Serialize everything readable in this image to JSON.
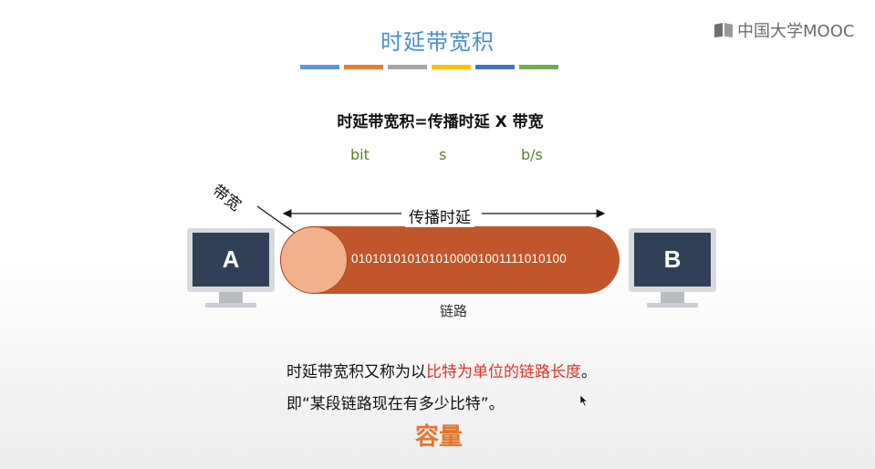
{
  "slide": {
    "title": "时延带宽积",
    "color_bar": [
      "#5b9bd5",
      "#ed7d31",
      "#a5a5a5",
      "#ffc000",
      "#4472c4",
      "#70ad47"
    ]
  },
  "logo": {
    "text": "中国大学MOOC"
  },
  "formula": {
    "text": "时延带宽积=传播时延 X 带宽",
    "units": {
      "delay_product": "bit",
      "propagation": "s",
      "bandwidth": "b/s"
    }
  },
  "diagram": {
    "host_a": "A",
    "host_b": "B",
    "bits": "0101010101010100001001111010100",
    "propagation_label": "传播时延",
    "bandwidth_label": "带宽",
    "link_label": "链路",
    "pipe_color": "#c0562a",
    "cap_color": "#f2b08d"
  },
  "description": {
    "line1_prefix": "时延带宽积又称为以",
    "line1_highlight": "比特为单位的链路长度",
    "line1_suffix": "。",
    "line2": "即“某段链路现在有多少比特”。",
    "keyword": "容量"
  }
}
